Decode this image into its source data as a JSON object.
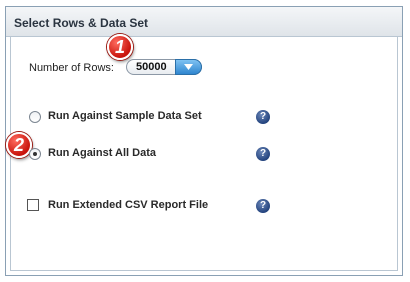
{
  "panel": {
    "title": "Select Rows & Data Set"
  },
  "rows": {
    "label": "Number of Rows:",
    "selected": "50000"
  },
  "badges": {
    "step1": "1",
    "step2": "2"
  },
  "options": [
    {
      "label": "Run Against Sample Data Set",
      "checked": false
    },
    {
      "label": "Run Against All Data",
      "checked": true
    }
  ],
  "csv": {
    "label": "Run Extended CSV Report File",
    "checked": false
  },
  "help": {
    "glyph": "?"
  },
  "colors": {
    "badge": "#c8140c",
    "select_arrow": "#2f86cf",
    "help": "#1f3f7a",
    "border": "#8aa0b4"
  }
}
